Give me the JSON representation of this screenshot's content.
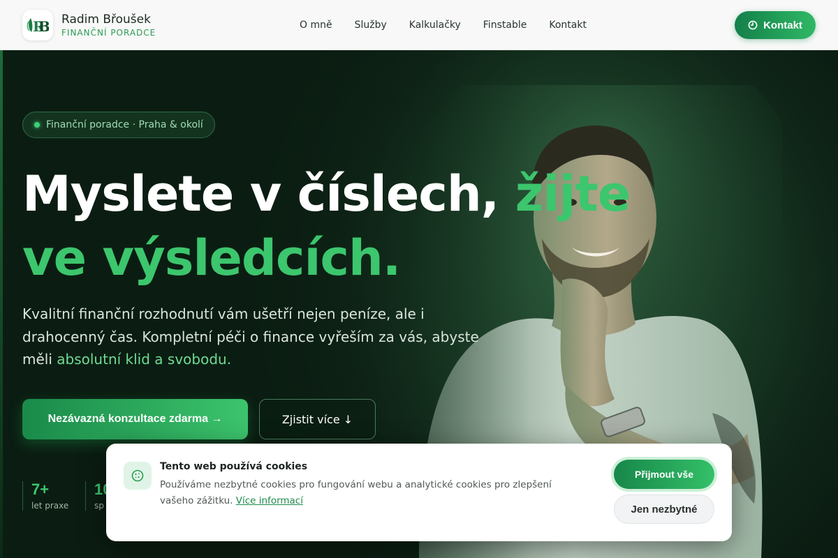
{
  "header": {
    "brand_name": "Radim Břoušek",
    "brand_subtitle": "FINANČNÍ PORADCE",
    "logo_icon": "rb-monogram-leaf-logo",
    "nav": [
      "O mně",
      "Služby",
      "Kalkulačky",
      "Finstable",
      "Kontakt"
    ],
    "contact_button": "Kontakt",
    "contact_icon": "clock-icon"
  },
  "hero": {
    "badge": "Finanční poradce · Praha & okolí",
    "headline_white": "Myslete v číslech, ",
    "headline_green_1": "žijte",
    "headline_green_2": "ve výsledcích.",
    "lead_text": "Kvalitní finanční rozhodnutí vám ušetří nejen peníze, ale i drahocenný čas. Kompletní péči o finance vyřeším za vás, abyste měli ",
    "lead_highlight": "absolutní klid a svobodu.",
    "cta_primary": "Nezávazná konzultace zdarma →",
    "cta_secondary": "Zjistit více ↓",
    "stats": [
      {
        "value": "7+",
        "label": "let praxe"
      },
      {
        "value": "10",
        "label": "sp"
      }
    ]
  },
  "cookie": {
    "icon": "cookie-icon",
    "title": "Tento web používá cookies",
    "text": "Používáme nezbytné cookies pro fungování webu a analytické cookies pro zlepšení vašeho zážitku. ",
    "link": "Více informací",
    "accept": "Přijmout vše",
    "necessary": "Jen nezbytné"
  },
  "colors": {
    "accent": "#3cc66d",
    "accent_dark": "#14804a",
    "hero_bg": "#0f2618",
    "header_bg": "#f7f8f7"
  }
}
